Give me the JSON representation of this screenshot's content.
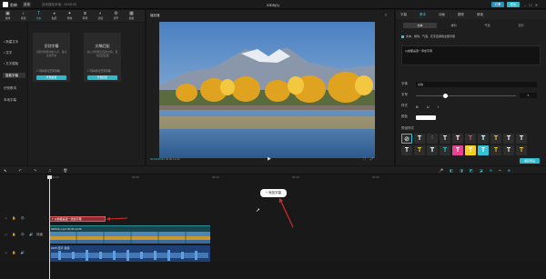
{
  "titlebar": {
    "app_name": "剪映",
    "menu_label": "菜单",
    "autosave": "自动保存本地：00:00:00",
    "project_title": "0305(1)",
    "share_label": "分享",
    "export_label": "导出"
  },
  "toolbar": {
    "items": [
      {
        "label": "媒体",
        "icon": "media-icon"
      },
      {
        "label": "音频",
        "icon": "audio-icon"
      },
      {
        "label": "文本",
        "icon": "text-icon"
      },
      {
        "label": "贴纸",
        "icon": "sticker-icon"
      },
      {
        "label": "特效",
        "icon": "effects-icon"
      },
      {
        "label": "转场",
        "icon": "transition-icon"
      },
      {
        "label": "滤镜",
        "icon": "filter-icon"
      },
      {
        "label": "调节",
        "icon": "adjust-icon"
      },
      {
        "label": "模板",
        "icon": "template-icon"
      }
    ],
    "active_index": 2
  },
  "sidenav": {
    "items": [
      "• 新建文本",
      "• 花字",
      "• 文字模板",
      "智能字幕",
      "识别歌词",
      "本地字幕"
    ],
    "active_index": 3
  },
  "cards": [
    {
      "title": "识别字幕",
      "desc": "识别音视频中的人声，自动生成字幕",
      "checkbox": "同时清空已有字幕",
      "button": "开始识别"
    },
    {
      "title": "文稿匹配",
      "desc": "输入音视频对应的文稿，自动匹配画面",
      "checkbox": "同时清空已有字幕",
      "button": "开始匹配"
    }
  ],
  "player": {
    "title": "播放器",
    "timecode_current": "00:00:00:00",
    "timecode_total": "00:00:14:26",
    "menu_icon": "menu-icon"
  },
  "rightpanel": {
    "tabs": [
      "字幕",
      "基本",
      "动画",
      "跟踪",
      "朗读"
    ],
    "active_tab": 1,
    "subtabs": [
      "文本",
      "排列",
      "气泡",
      "花字"
    ],
    "active_subtab": 0,
    "apply_all": "文本、排列、气泡、花字应用到全部字幕",
    "text_value": "以前都是逐一添加字幕",
    "font_label": "字体",
    "font_value": "系统",
    "size_label": "字号",
    "size_value": "5",
    "style_label": "样式",
    "color_label": "颜色",
    "presets_label": "预设样式",
    "preset_button": "保存预设"
  },
  "timeline": {
    "ticks": [
      "00:00",
      "00:05",
      "00:10",
      "00:15",
      "00:20"
    ],
    "add_subtitle_label": "+ 添加字幕",
    "cover_label": "封面",
    "subtitle_clip": "T 以前都是逐一添加字幕",
    "video_clip": "0305(1).mp4  00:00:14:26",
    "audio_clip": "0305 原声 音频"
  },
  "colors": {
    "accent": "#2fc4d6",
    "video_clip": "#16474f",
    "audio_clip": "#1d3f73",
    "subtitle_clip": "#8a2e33"
  }
}
